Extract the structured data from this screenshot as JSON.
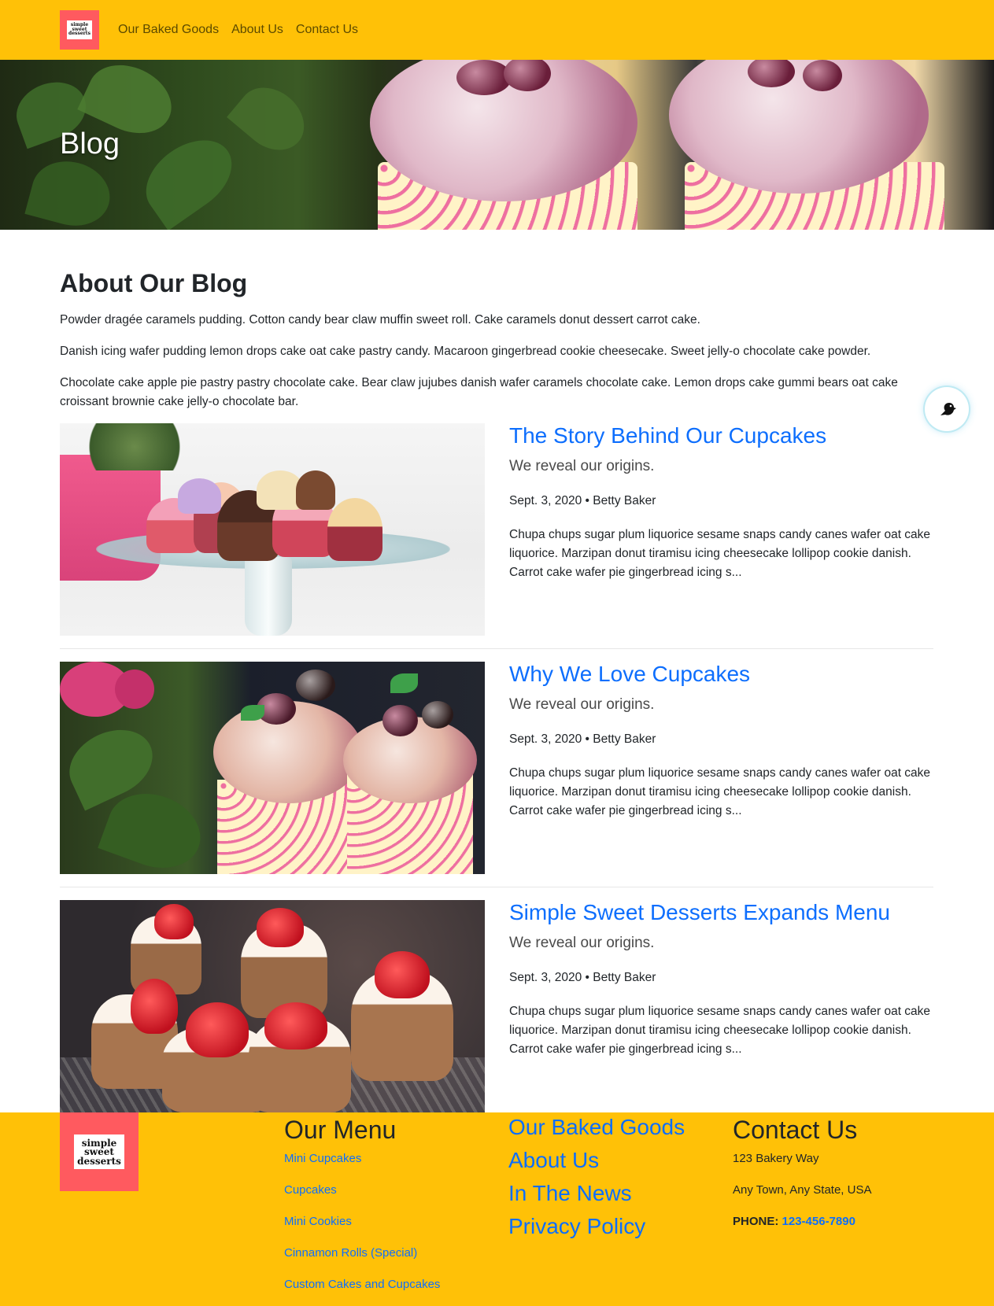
{
  "nav": {
    "logo_text": "simple sweet desserts",
    "links": [
      "Our Baked Goods",
      "About Us",
      "Contact Us"
    ]
  },
  "hero": {
    "title": "Blog"
  },
  "about": {
    "heading": "About Our Blog",
    "paragraphs": [
      "Powder dragée caramels pudding. Cotton candy bear claw muffin sweet roll. Cake caramels donut dessert carrot cake.",
      "Danish icing wafer pudding lemon drops cake oat cake pastry candy. Macaroon gingerbread cookie cheesecake. Sweet jelly-o chocolate cake powder.",
      "Chocolate cake apple pie pastry pastry chocolate cake. Bear claw jujubes danish wafer caramels chocolate cake. Lemon drops cake gummi bears oat cake croissant brownie cake jelly-o chocolate bar."
    ]
  },
  "widget": {
    "icon": "bird-icon"
  },
  "posts": [
    {
      "title": "The Story Behind Our Cupcakes",
      "subtitle": "We reveal our origins.",
      "meta": "Sept. 3, 2020 • Betty Baker",
      "excerpt": "Chupa chups sugar plum liquorice sesame snaps candy canes wafer oat cake liquorice. Marzipan donut tiramisu icing cheesecake lollipop cookie danish. Carrot cake wafer pie gingerbread icing s..."
    },
    {
      "title": "Why We Love Cupcakes",
      "subtitle": "We reveal our origins.",
      "meta": "Sept. 3, 2020 • Betty Baker",
      "excerpt": "Chupa chups sugar plum liquorice sesame snaps candy canes wafer oat cake liquorice. Marzipan donut tiramisu icing cheesecake lollipop cookie danish. Carrot cake wafer pie gingerbread icing s..."
    },
    {
      "title": "Simple Sweet Desserts Expands Menu",
      "subtitle": "We reveal our origins.",
      "meta": "Sept. 3, 2020 • Betty Baker",
      "excerpt": "Chupa chups sugar plum liquorice sesame snaps candy canes wafer oat cake liquorice. Marzipan donut tiramisu icing cheesecake lollipop cookie danish. Carrot cake wafer pie gingerbread icing s..."
    }
  ],
  "footer": {
    "logo_text": "simple sweet desserts",
    "menu_heading": "Our Menu",
    "menu_items": [
      "Mini Cupcakes",
      "Cupcakes",
      "Mini Cookies",
      "Cinnamon Rolls (Special)",
      "Custom Cakes and Cupcakes"
    ],
    "links": [
      "Our Baked Goods",
      "About Us",
      "In The News",
      "Privacy Policy"
    ],
    "contact_heading": "Contact Us",
    "address_line1": "123 Bakery Way",
    "address_line2": "Any Town, Any State, USA",
    "phone_label": "PHONE:",
    "phone_number": "123-456-7890"
  },
  "colors": {
    "brand_yellow": "#ffc107",
    "logo_red": "#ff5a5f",
    "link_blue": "#0d6efd"
  }
}
